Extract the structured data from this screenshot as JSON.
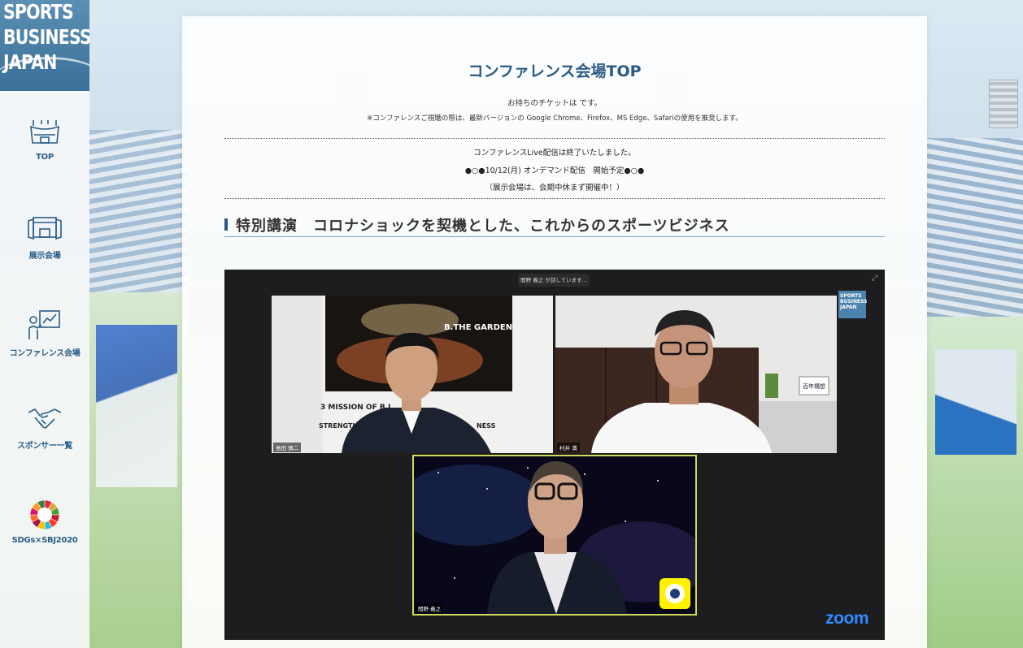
{
  "logo": {
    "lines": [
      "SPORTS",
      "BUSINESS",
      "JAPAN"
    ]
  },
  "sidebar": {
    "items": [
      {
        "label": "TOP",
        "icon": "stadium-icon"
      },
      {
        "label": "展示会場",
        "icon": "booth-icon"
      },
      {
        "label": "コンファレンス会場",
        "icon": "presenter-icon"
      },
      {
        "label": "スポンサー一覧",
        "icon": "handshake-icon"
      },
      {
        "label": "SDGs×SBJ2020",
        "icon": "sdgs-wheel-icon"
      }
    ]
  },
  "main": {
    "title": "コンファレンス会場TOP",
    "ticket_text": "お持ちのチケットは です。",
    "browser_note": "※コンファレンスご視聴の際は、最新バージョンの Google Chrome、Firefox、MS Edge、Safariの使用を推奨します。",
    "notice_lines": [
      "コンファレンスLive配信は終了いたしました。",
      "●○●10/12(月) オンデマンド配信　開始予定●○●",
      "（展示会場は、会期中休まず開催中！）"
    ],
    "section_title": "特別講演　コロナショックを契機とした、これからのスポーツビジネス"
  },
  "video": {
    "speaking_text": "間野 義之 が話しています...",
    "participants": [
      {
        "name": "島田 慎二"
      },
      {
        "name": "村井 満"
      },
      {
        "name": "間野 義之"
      }
    ],
    "badge_lines": [
      "SPORTS",
      "BUSINESS",
      "JAPAN"
    ],
    "zoom_label": "zoom",
    "backdrop_text": "B.THE GARDEN",
    "backdrop_text_2": "3 MISSION OF B.L",
    "backdrop_text_3": "STRENGTH",
    "backdrop_text_4": "NESS",
    "shelf_sign": "百年構想"
  },
  "colors": {
    "brand_blue": "#2b5b83",
    "logo_blue": "#3a6f98",
    "zoom_blue": "#2d8cff",
    "highlight_border": "#cfd95a"
  }
}
